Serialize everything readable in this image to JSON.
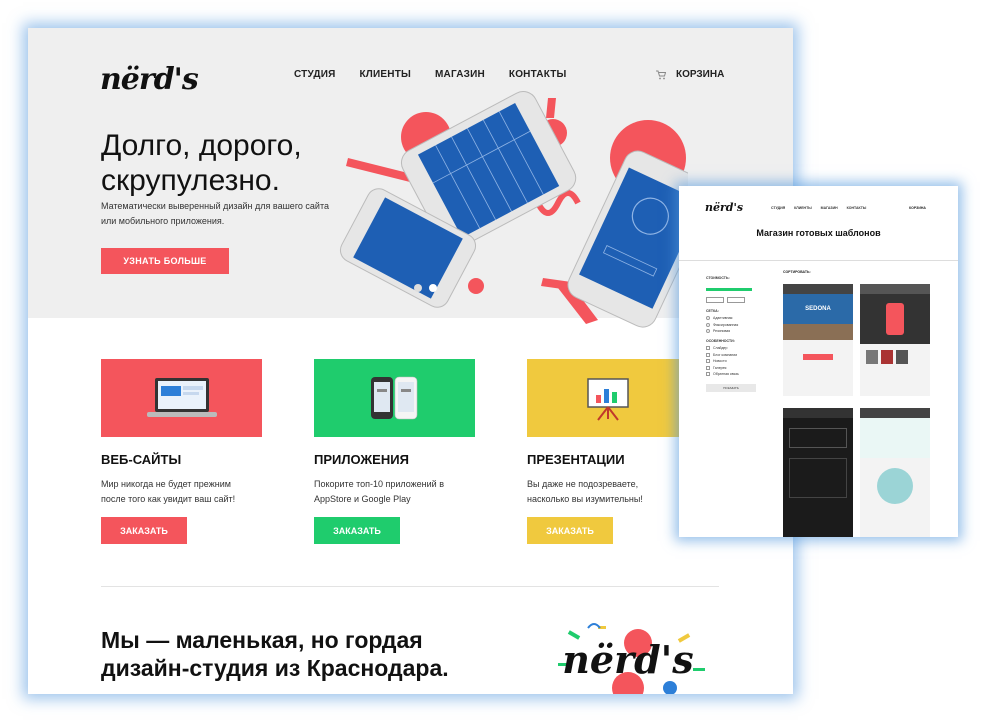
{
  "site": {
    "logo": "nërd's",
    "nav": [
      "СТУДИЯ",
      "КЛИЕНТЫ",
      "МАГАЗИН",
      "КОНТАКТЫ"
    ],
    "cart_label": "КОРЗИНА"
  },
  "hero": {
    "headline": "Долго, дорого, скрупулезно.",
    "subtitle": "Математически выверенный дизайн для вашего сайта или мобильного приложения.",
    "cta": "УЗНАТЬ БОЛЬШЕ"
  },
  "services": [
    {
      "title": "ВЕБ-САЙТЫ",
      "text": "Мир никогда не будет прежним после того как увидит ваш сайт!",
      "button": "ЗАКАЗАТЬ",
      "color": "#f4555c"
    },
    {
      "title": "ПРИЛОЖЕНИЯ",
      "text": "Покорите топ-10 приложений в AppStore и Google Play",
      "button": "ЗАКАЗАТЬ",
      "color": "#1fcc6d"
    },
    {
      "title": "ПРЕЗЕНТАЦИИ",
      "text": "Вы даже не подозреваете, насколько вы изумительны!",
      "button": "ЗАКАЗАТЬ",
      "color": "#f0c93e"
    }
  ],
  "about": {
    "text": "Мы — маленькая, но гордая дизайн-студия из Краснодара."
  },
  "shop": {
    "logo": "nërd's",
    "nav": [
      "СТУДИЯ",
      "КЛИЕНТЫ",
      "МАГАЗИН",
      "КОНТАКТЫ"
    ],
    "cart_label": "КОРЗИНА",
    "title": "Магазин готовых шаблонов",
    "filters": {
      "price_label": "СТОИМОСТЬ:",
      "sort_label": "СОРТИРОВАТЬ:",
      "grid_label": "СЕТКА:",
      "grid_options": [
        "Адаптивная",
        "Фиксированная",
        "Резиновая"
      ],
      "features_label": "ОСОБЕННОСТИ:",
      "features": [
        "Слайдер",
        "Блог компании",
        "Новости",
        "Галерея",
        "Обратная связь"
      ],
      "apply_button": "ПОКАЗАТЬ"
    },
    "tiles": [
      "SEDONA"
    ]
  },
  "colors": {
    "accent_red": "#f4555c",
    "accent_green": "#1fcc6d",
    "accent_yellow": "#f0c93e",
    "phone_blue": "#1e5fb4",
    "frame_glow": "#5096dc"
  }
}
